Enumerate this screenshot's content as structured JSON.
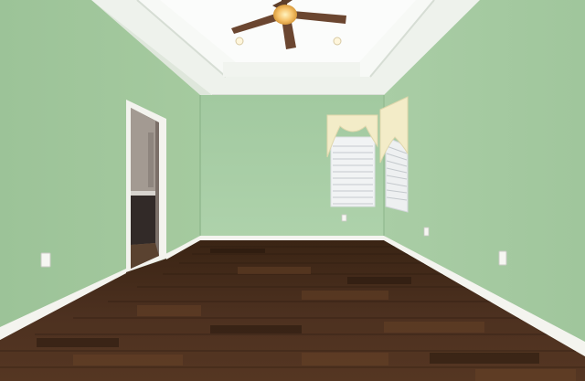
{
  "scene": {
    "kind": "interior-room-photo",
    "objects": [
      "ceiling-fan",
      "tray-ceiling",
      "recessed-lights",
      "doorway",
      "window-left",
      "window-right",
      "valances",
      "baseboards",
      "hardwood-floor",
      "outlets"
    ]
  },
  "colors": {
    "wall_back": "#a8cea6",
    "wall_left": "#9fc69c",
    "wall_right": "#a4c9a1",
    "ceiling": "#f2f5f1",
    "ceiling_tray": "#fbfcfa",
    "floor_dark": "#2f1d12",
    "floor_mid": "#4a2f1c",
    "floor_light": "#6a4428",
    "baseboard": "#f4f4ef",
    "valance": "#f3ecc8",
    "blind": "#e9ecef",
    "fan_blade": "#6b4630",
    "fan_light": "#f6c26a",
    "door_trim": "#f3f3ee",
    "interior_dark": "#5b524d"
  }
}
